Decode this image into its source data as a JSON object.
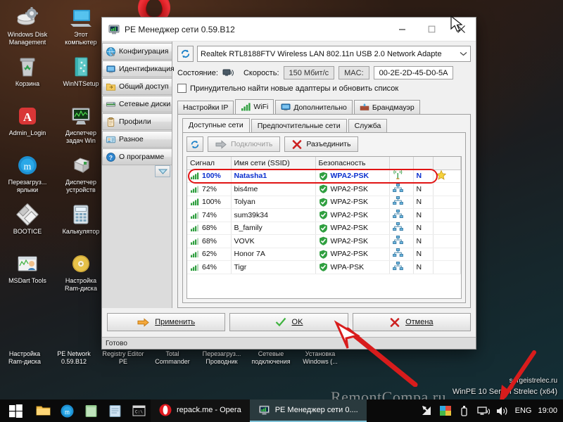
{
  "desktop": {
    "icons": [
      {
        "label": "Windows Disk\nManagement",
        "icon": "disk-gear-icon"
      },
      {
        "label": "Этот\nкомпьютер",
        "icon": "this-pc-icon"
      },
      {
        "label": "Корзина",
        "icon": "recycle-bin-icon"
      },
      {
        "label": "WinNTSetup",
        "icon": "winntsetup-icon"
      },
      {
        "label": "Admin_Login",
        "icon": "admin-login-icon"
      },
      {
        "label": "Диспетчер\nзадач Win",
        "icon": "task-manager-icon"
      },
      {
        "label": "Перезагруз...\nярлыки",
        "icon": "reload-shortcuts-icon"
      },
      {
        "label": "Диспетчер\nустройств",
        "icon": "device-manager-icon"
      },
      {
        "label": "BOOTICE",
        "icon": "bootice-icon"
      },
      {
        "label": "Калькулятор",
        "icon": "calculator-icon"
      },
      {
        "label": "MSDart Tools",
        "icon": "msdart-icon"
      },
      {
        "label": "Настройка\nRam-диска",
        "icon": "ramdisk-icon"
      }
    ],
    "hidden_row_labels": [
      "Настройка\nRam-диска",
      "PE Network\n0.59.B12",
      "Registry Editor\nPE",
      "Total\nCommander",
      "Перезагруз...\nПроводник",
      "Сетевые\nподключения",
      "Установка\nWindows (..."
    ],
    "watermarks": {
      "site": "sergeistrelec.ru",
      "winpe": "WinPE 10 Sergei Strelec (x64)",
      "remont": "RemontCompa.ru"
    }
  },
  "window": {
    "title": "PE Менеджер сети 0.59.B12",
    "icon": "network-monitor-icon",
    "controls": {
      "minimize": "—",
      "maximize": "▢",
      "close": "✕"
    },
    "status_bar": "Готово"
  },
  "sidebar": {
    "items": [
      {
        "label": "Конфигурация",
        "icon": "globe-icon",
        "selected": false
      },
      {
        "label": "Идентификация",
        "icon": "monitor-icon",
        "selected": true
      },
      {
        "label": "Общий доступ",
        "icon": "folder-share-icon",
        "selected": false
      },
      {
        "label": "Сетевые диски",
        "icon": "network-drive-icon",
        "selected": false
      },
      {
        "label": "Профили",
        "icon": "clipboard-icon",
        "selected": false
      },
      {
        "label": "Разное",
        "icon": "misc-card-icon",
        "selected": false
      },
      {
        "label": "О программе",
        "icon": "help-icon",
        "selected": false
      }
    ],
    "collapse_icon": "chevron-down-icon"
  },
  "adapter": {
    "refresh_icon": "refresh-icon",
    "selected": "Realtek RTL8188FTV Wireless LAN 802.11n USB 2.0 Network Adapte",
    "dropdown_icon": "chevron-down-icon"
  },
  "status": {
    "state_label": "Состояние:",
    "state_icon": "connected-monitor-icon",
    "speed_label": "Скорость:",
    "speed_value": "150 Мбит/с",
    "mac_label": "MAC:",
    "mac_value": "00-2E-2D-45-D0-5A",
    "force_checkbox_label": "Принудительно найти новые адаптеры и обновить список",
    "force_checkbox_checked": false
  },
  "tabs_outer": [
    {
      "label": "Настройки IP",
      "icon": "",
      "active": false
    },
    {
      "label": "WiFi",
      "icon": "signal-bars-icon",
      "active": true
    },
    {
      "label": "Дополнительно",
      "icon": "monitor-icon",
      "active": false
    },
    {
      "label": "Брандмауэр",
      "icon": "firewall-icon",
      "active": false
    }
  ],
  "tabs_inner": [
    {
      "label": "Доступные сети",
      "active": true
    },
    {
      "label": "Предпочтительные сети",
      "active": false
    },
    {
      "label": "Служба",
      "active": false
    }
  ],
  "list_toolbar": {
    "refresh_icon": "refresh-icon",
    "connect_label": "Подключить",
    "connect_icon": "arrow-right-icon",
    "connect_disabled": true,
    "disconnect_label": "Разъединить",
    "disconnect_icon": "red-x-icon"
  },
  "networks": {
    "columns": [
      "Сигнал",
      "Имя сети (SSID)",
      "Безопасность",
      "",
      "",
      ""
    ],
    "rows": [
      {
        "signal": "100%",
        "ssid": "Natasha1",
        "security": "WPA2-PSK",
        "type_icon": "wifi-broadcast-icon",
        "mode": "N",
        "fav": "star-icon",
        "selected": true
      },
      {
        "signal": "72%",
        "ssid": "bis4me",
        "security": "WPA2-PSK",
        "type_icon": "network-nodes-icon",
        "mode": "N",
        "fav": "",
        "selected": false
      },
      {
        "signal": "100%",
        "ssid": "Tolyan",
        "security": "WPA2-PSK",
        "type_icon": "network-nodes-icon",
        "mode": "N",
        "fav": "",
        "selected": false
      },
      {
        "signal": "74%",
        "ssid": "sum39k34",
        "security": "WPA2-PSK",
        "type_icon": "network-nodes-icon",
        "mode": "N",
        "fav": "",
        "selected": false
      },
      {
        "signal": "68%",
        "ssid": "B_family",
        "security": "WPA2-PSK",
        "type_icon": "network-nodes-icon",
        "mode": "N",
        "fav": "",
        "selected": false
      },
      {
        "signal": "68%",
        "ssid": "VOVK",
        "security": "WPA2-PSK",
        "type_icon": "network-nodes-icon",
        "mode": "N",
        "fav": "",
        "selected": false
      },
      {
        "signal": "62%",
        "ssid": "Honor 7A",
        "security": "WPA2-PSK",
        "type_icon": "network-nodes-icon",
        "mode": "N",
        "fav": "",
        "selected": false
      },
      {
        "signal": "64%",
        "ssid": "Tigr",
        "security": "WPA-PSK",
        "type_icon": "network-nodes-icon",
        "mode": "N",
        "fav": "",
        "selected": false
      }
    ]
  },
  "bottom_buttons": [
    {
      "label": "Применить",
      "icon": "orange-arrow-icon"
    },
    {
      "label": "OK",
      "icon": "green-check-icon"
    },
    {
      "label": "Отмена",
      "icon": "red-x-icon"
    }
  ],
  "taskbar": {
    "start_icon": "windows-logo-icon",
    "pinned": [
      {
        "icon": "file-explorer-icon"
      },
      {
        "icon": "mediaget-icon"
      },
      {
        "icon": "notepad-green-icon"
      },
      {
        "icon": "notepad-blue-icon"
      },
      {
        "icon": "command-prompt-icon"
      }
    ],
    "tasks": [
      {
        "label": "repack.me - Opera",
        "icon": "opera-icon",
        "active": false
      },
      {
        "label": "PE Менеджер сети 0....",
        "icon": "network-monitor-icon",
        "active": true
      }
    ],
    "tray": [
      {
        "icon": "resize-arrow-icon"
      },
      {
        "icon": "color-square-icon"
      },
      {
        "icon": "usb-eject-icon"
      },
      {
        "icon": "network-icon"
      },
      {
        "icon": "volume-icon"
      }
    ],
    "language": "ENG",
    "clock": "19:00"
  },
  "colors": {
    "accent_red": "#e11414",
    "selected_text": "#0a2fcf",
    "taskbar": "#0a0a0a",
    "window_bg": "#f0f0f0"
  }
}
